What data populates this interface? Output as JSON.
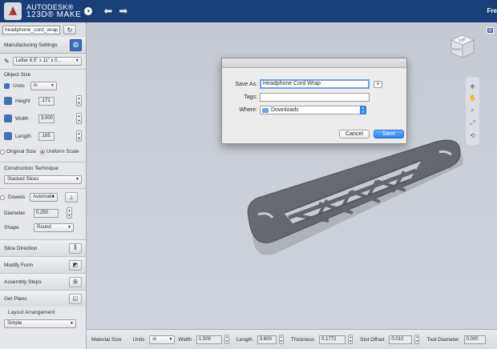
{
  "app": {
    "brand_line1": "AUTODESK®",
    "brand_line2": "123D® MAKE",
    "right_text": "Fre"
  },
  "panel": {
    "filename": "headphone_cord_wrap",
    "manufacturing_settings": "Manufacturing Settings",
    "material": "Letter 8.5\" x 11\" x 0...",
    "object_size": "Object Size",
    "units_label": "Units",
    "units_value": "in",
    "height_label": "Height",
    "height_value": ".171",
    "width_label": "Width",
    "width_value": "3.000",
    "length_label": "Length",
    "length_value": ".165",
    "original_size": "Original Size",
    "uniform_scale": "Uniform Scale",
    "construction_technique": "Construction Technique",
    "technique_value": "Stacked Slices",
    "dowels_label": "Dowels",
    "dowels_value": "Automatic",
    "diameter_label": "Diameter",
    "diameter_value": "0.250",
    "shape_label": "Shape",
    "shape_value": "Round",
    "slice_direction": "Slice Direction",
    "modify_form": "Modify Form",
    "assembly_steps": "Assembly Steps",
    "get_plans": "Get Plans",
    "layout_arrangement": "Layout Arrangement",
    "layout_value": "Simple"
  },
  "dialog": {
    "save_as_label": "Save As:",
    "save_as_value": "Headphone Cord Wrap",
    "tags_label": "Tags:",
    "tags_value": "",
    "where_label": "Where:",
    "where_value": "Downloads",
    "cancel": "Cancel",
    "save": "Save"
  },
  "viewcube": {
    "top": "TOP",
    "front": "FRONT"
  },
  "bottombar": {
    "material_size": "Material Size",
    "units_label": "Units",
    "units_value": "in",
    "width_label": "Width",
    "width_value": "1.500",
    "length_label": "Length",
    "length_value": "3.600",
    "thickness_label": "Thickness",
    "thickness_value": "0.1772",
    "slot_offset_label": "Slot Offset",
    "slot_offset_value": "0.010",
    "tool_diameter_label": "Tool Diameter",
    "tool_diameter_value": "0.000"
  },
  "colors": {
    "titlebar": "#1a3f78",
    "accent": "#3a6fc2",
    "save_button": "#2a7ff0"
  },
  "icons": [
    "app-logo-icon",
    "undo-icon",
    "redo-icon",
    "refresh-icon",
    "gear-icon",
    "pencil-icon",
    "units-icon",
    "height-icon",
    "width-icon",
    "length-icon",
    "dowel-icon",
    "slice-icon",
    "modify-icon",
    "assembly-icon",
    "plans-icon",
    "pan-icon",
    "orbit-icon",
    "zoom-icon",
    "fit-icon",
    "look-icon",
    "folder-icon"
  ]
}
